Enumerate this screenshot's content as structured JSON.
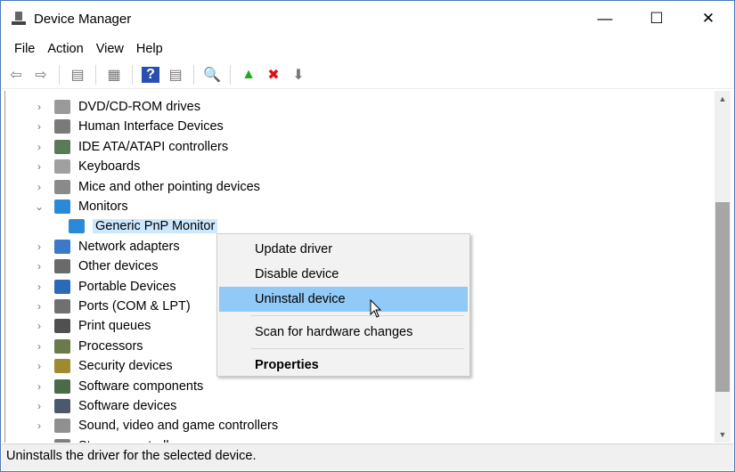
{
  "window": {
    "title": "Device Manager",
    "minimize": "—",
    "maximize": "☐",
    "close": "✕"
  },
  "menus": [
    "File",
    "Action",
    "View",
    "Help"
  ],
  "toolbar": [
    {
      "name": "back-icon",
      "glyph": "⇦"
    },
    {
      "name": "forward-icon",
      "glyph": "⇨"
    },
    {
      "sep": true
    },
    {
      "name": "show-hide-console-tree-icon",
      "glyph": "▤"
    },
    {
      "sep": true
    },
    {
      "name": "properties-icon",
      "glyph": "▦"
    },
    {
      "sep": true
    },
    {
      "name": "help-icon",
      "glyph": "?"
    },
    {
      "name": "action-pane-icon",
      "glyph": "▤"
    },
    {
      "sep": true
    },
    {
      "name": "scan-hardware-icon",
      "glyph": "🔍"
    },
    {
      "sep": true
    },
    {
      "name": "update-driver-icon",
      "glyph": "▲"
    },
    {
      "name": "uninstall-icon",
      "glyph": "✖"
    },
    {
      "name": "disable-device-icon",
      "glyph": "⬇"
    }
  ],
  "tree": [
    {
      "label": "DVD/CD-ROM drives",
      "color": "#9a9a9a"
    },
    {
      "label": "Human Interface Devices",
      "color": "#7a7a7a"
    },
    {
      "label": "IDE ATA/ATAPI controllers",
      "color": "#5a7a5a"
    },
    {
      "label": "Keyboards",
      "color": "#a0a0a0"
    },
    {
      "label": "Mice and other pointing devices",
      "color": "#8a8a8a"
    },
    {
      "label": "Monitors",
      "color": "#2a8ad8",
      "expanded": true
    },
    {
      "label": "Generic PnP Monitor",
      "color": "#2a8ad8",
      "child": true,
      "selected": true
    },
    {
      "label": "Network adapters",
      "color": "#3a7ac8"
    },
    {
      "label": "Other devices",
      "color": "#6a6a6a"
    },
    {
      "label": "Portable Devices",
      "color": "#2a6ab8"
    },
    {
      "label": "Ports (COM & LPT)",
      "color": "#707070"
    },
    {
      "label": "Print queues",
      "color": "#505050"
    },
    {
      "label": "Processors",
      "color": "#6a7a4a"
    },
    {
      "label": "Security devices",
      "color": "#a08a30"
    },
    {
      "label": "Software components",
      "color": "#4a6a4a"
    },
    {
      "label": "Software devices",
      "color": "#4a5a6a"
    },
    {
      "label": "Sound, video and game controllers",
      "color": "#909090"
    },
    {
      "label": "Storage controllers",
      "color": "#808080"
    }
  ],
  "context_menu": {
    "items": [
      "Update driver",
      "Disable device",
      "Uninstall device",
      "Scan for hardware changes",
      "Properties"
    ],
    "highlighted": "Uninstall device"
  },
  "status": "Uninstalls the driver for the selected device."
}
